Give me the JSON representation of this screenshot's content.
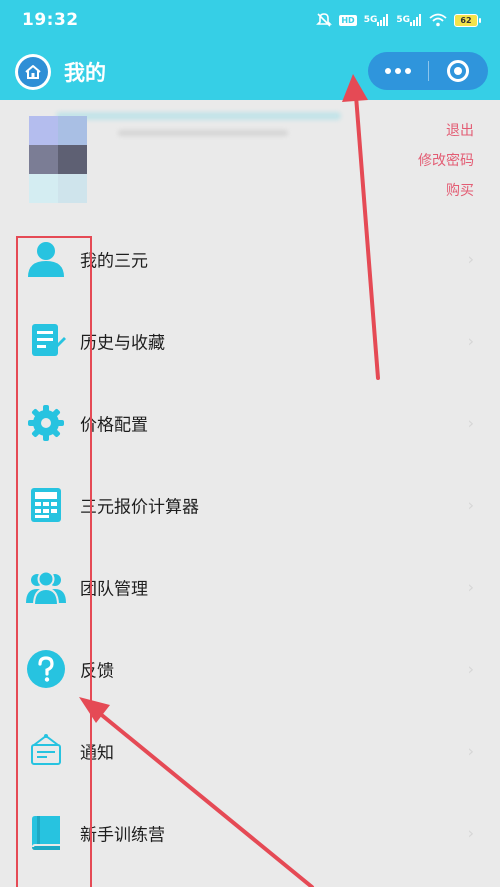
{
  "status_bar": {
    "time": "19:32",
    "hd_label": "HD",
    "net1_label": "5G",
    "net2_label": "5G",
    "battery_level": "62"
  },
  "nav": {
    "title": "我的",
    "home_icon": "home-icon",
    "more_icon": "more-dots-icon",
    "target_icon": "target-icon"
  },
  "profile": {
    "logout": "退出",
    "change_password": "修改密码",
    "buy": "购买"
  },
  "menu": {
    "items": [
      {
        "label": "我的三元",
        "icon": "person-icon"
      },
      {
        "label": "历史与收藏",
        "icon": "notes-icon"
      },
      {
        "label": "价格配置",
        "icon": "gear-icon"
      },
      {
        "label": "三元报价计算器",
        "icon": "calculator-icon"
      },
      {
        "label": "团队管理",
        "icon": "team-icon"
      },
      {
        "label": "反馈",
        "icon": "question-icon"
      },
      {
        "label": "通知",
        "icon": "notice-icon"
      },
      {
        "label": "新手训练营",
        "icon": "book-icon"
      }
    ],
    "chevron": "›"
  },
  "colors": {
    "header": "#36cfe6",
    "capsule": "#2f95dc",
    "accent_icon": "#27c3e0",
    "link": "#e35d74",
    "annotation": "#e54a55",
    "background": "#eaeaea"
  }
}
